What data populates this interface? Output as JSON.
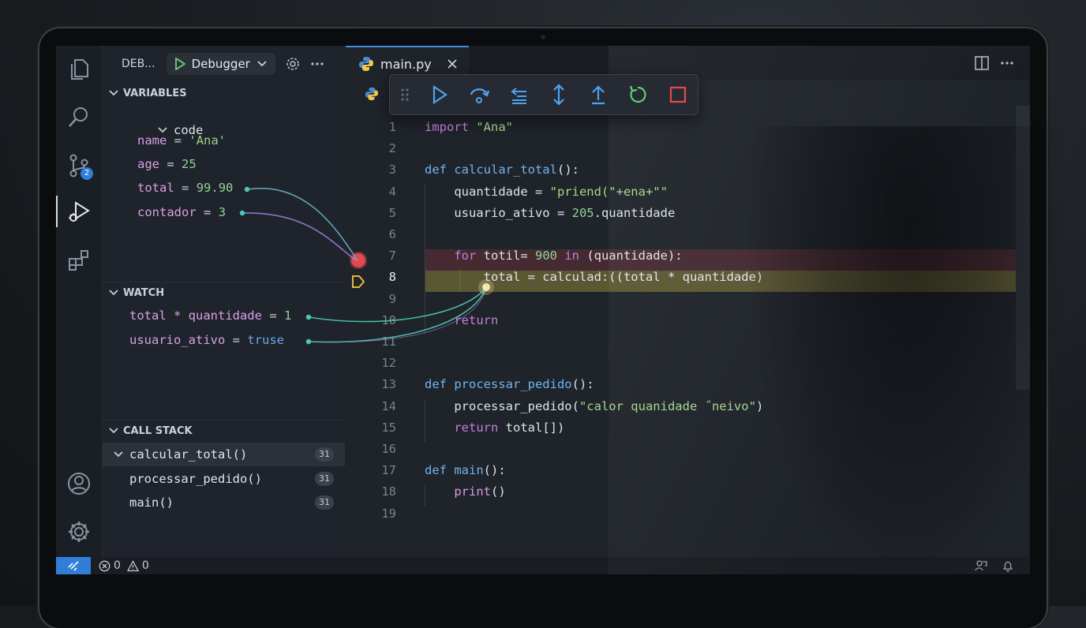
{
  "colors": {
    "accent": "#2f7fd8",
    "breakpoint": "#e5484d",
    "execution_arrow": "#e6b73d",
    "wire_teal": "#4ec9b0",
    "wire_purple": "#9d86e0"
  },
  "activity_bar": {
    "items": [
      {
        "icon": "files-icon"
      },
      {
        "icon": "search-icon"
      },
      {
        "icon": "source-control-icon",
        "badge": "2"
      },
      {
        "icon": "run-debug-icon",
        "active": true
      },
      {
        "icon": "extensions-icon"
      }
    ],
    "bottom": [
      {
        "icon": "account-icon"
      },
      {
        "icon": "settings-gear-icon"
      }
    ]
  },
  "sidebar": {
    "title": "DEB...",
    "launch_config": "Debugger",
    "variables": {
      "header": "VARIABLES",
      "scope": "code",
      "items": [
        {
          "name": "name",
          "eq": "=",
          "value": "'Ana'"
        },
        {
          "name": "age",
          "eq": "=",
          "value": "25"
        },
        {
          "name": "total",
          "eq": "=",
          "value": "99.90"
        },
        {
          "name": "contador",
          "eq": "=",
          "value": "3"
        }
      ]
    },
    "watch": {
      "header": "WATCH",
      "items": [
        {
          "expr": "total * quantidade",
          "eq": "=",
          "value": "1"
        },
        {
          "expr": "usuario_ativo",
          "eq": "=",
          "value": "truse"
        }
      ]
    },
    "call_stack": {
      "header": "CALL STACK",
      "frames": [
        {
          "name": "calcular_total()",
          "line": "31"
        },
        {
          "name": "processar_pedido()",
          "line": "31"
        },
        {
          "name": "main()",
          "line": "31"
        }
      ]
    }
  },
  "editor": {
    "tab": {
      "name": "main.py",
      "icon": "python-icon"
    },
    "breadcrumb_icon": "python-icon",
    "breakpoint_line": 7,
    "current_line": 8,
    "lines": [
      {
        "n": "1",
        "tokens": [
          {
            "t": "import ",
            "c": "kw"
          },
          {
            "t": "\"Ana\"",
            "c": "str"
          }
        ]
      },
      {
        "n": "2",
        "tokens": []
      },
      {
        "n": "3",
        "tokens": [
          {
            "t": "def ",
            "c": "fn"
          },
          {
            "t": "calcular_total",
            "c": "fn"
          },
          {
            "t": "():",
            "c": ""
          }
        ]
      },
      {
        "n": "4",
        "tokens": [
          {
            "t": "    quantidade = ",
            "c": ""
          },
          {
            "t": "\"priend(\"+ena+\"\"",
            "c": "str"
          }
        ]
      },
      {
        "n": "5",
        "tokens": [
          {
            "t": "    usuario_ativo = ",
            "c": ""
          },
          {
            "t": "205",
            "c": "num"
          },
          {
            "t": ".quantidade",
            "c": ""
          }
        ]
      },
      {
        "n": "6",
        "tokens": []
      },
      {
        "n": "7",
        "tokens": [
          {
            "t": "    ",
            "c": ""
          },
          {
            "t": "for",
            "c": "kw"
          },
          {
            "t": " totil= ",
            "c": ""
          },
          {
            "t": "900",
            "c": "num"
          },
          {
            "t": " in ",
            "c": "kw"
          },
          {
            "t": "(quantidade):",
            "c": ""
          }
        ]
      },
      {
        "n": "8",
        "tokens": [
          {
            "t": "        total = calculad:((total * quantidade)",
            "c": ""
          }
        ]
      },
      {
        "n": "9",
        "tokens": []
      },
      {
        "n": "10",
        "tokens": [
          {
            "t": "    ",
            "c": ""
          },
          {
            "t": "return",
            "c": "kw"
          }
        ]
      },
      {
        "n": "11",
        "tokens": []
      },
      {
        "n": "12",
        "tokens": []
      },
      {
        "n": "13",
        "tokens": [
          {
            "t": "def ",
            "c": "fn"
          },
          {
            "t": "processar_pedido",
            "c": "fn"
          },
          {
            "t": "():",
            "c": ""
          }
        ]
      },
      {
        "n": "14",
        "tokens": [
          {
            "t": "    processar_pedido(",
            "c": ""
          },
          {
            "t": "\"calor quanidade ˝neivo\"",
            "c": "str"
          },
          {
            "t": ")",
            "c": ""
          }
        ]
      },
      {
        "n": "15",
        "tokens": [
          {
            "t": "    ",
            "c": ""
          },
          {
            "t": "return",
            "c": "kw"
          },
          {
            "t": " total[])",
            "c": ""
          }
        ]
      },
      {
        "n": "16",
        "tokens": []
      },
      {
        "n": "17",
        "tokens": [
          {
            "t": "def ",
            "c": "fn"
          },
          {
            "t": "main",
            "c": "fn"
          },
          {
            "t": "():",
            "c": ""
          }
        ]
      },
      {
        "n": "18",
        "tokens": [
          {
            "t": "    ",
            "c": ""
          },
          {
            "t": "print",
            "c": "builtin"
          },
          {
            "t": "()",
            "c": ""
          }
        ]
      },
      {
        "n": "19",
        "tokens": []
      }
    ]
  },
  "debug_toolbar": {
    "buttons": [
      "continue-icon",
      "step-over-icon",
      "step-into-icon",
      "step-out-icon",
      "step-up-icon",
      "restart-icon",
      "stop-icon"
    ]
  },
  "status_bar": {
    "errors": "0",
    "warnings": "0"
  }
}
